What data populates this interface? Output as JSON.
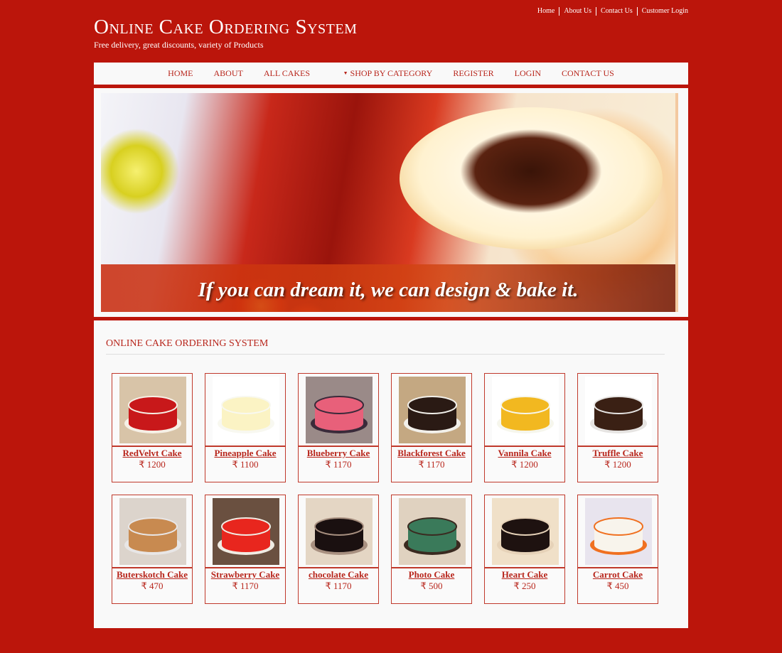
{
  "top_links": [
    "Home",
    "About Us",
    "Contact Us",
    "Customer Login"
  ],
  "brand": {
    "title": "Online Cake Ordering System",
    "tagline": "Free delivery, great discounts, variety of Products"
  },
  "main_nav": {
    "home": "HOME",
    "about": "ABOUT",
    "all_cakes": "ALL CAKES",
    "shop_by_category": "SHOP BY CATEGORY",
    "register": "REGISTER",
    "login": "LOGIN",
    "contact_us": "CONTACT US"
  },
  "banner": {
    "caption": "If you can dream it, we can design & bake it."
  },
  "section_title": "ONLINE CAKE ORDERING SYSTEM",
  "currency_symbol": "₹",
  "products": [
    {
      "name": "RedVelvt Cake",
      "price": "₹ 1200",
      "colors": [
        "#c8181a",
        "#f6f0e6",
        "#d8c4a8"
      ]
    },
    {
      "name": "Pineapple Cake",
      "price": "₹ 1100",
      "colors": [
        "#fbf3c4",
        "#f8f8f0",
        "#ffffff"
      ]
    },
    {
      "name": "Blueberry Cake",
      "price": "₹ 1170",
      "colors": [
        "#e8607a",
        "#3a2a3a",
        "#9a8a88"
      ]
    },
    {
      "name": "Blackforest Cake",
      "price": "₹ 1170",
      "colors": [
        "#2a1a14",
        "#f2f0ea",
        "#c4a882"
      ]
    },
    {
      "name": "Vannila Cake",
      "price": "₹ 1200",
      "colors": [
        "#f2b820",
        "#f6f6ec",
        "#ffffff"
      ]
    },
    {
      "name": "Truffle Cake",
      "price": "₹ 1200",
      "colors": [
        "#3a2014",
        "#e6e4e2",
        "#ffffff"
      ]
    },
    {
      "name": "Buterskotch Cake",
      "price": "₹ 470",
      "colors": [
        "#c88a50",
        "#e8e6e6",
        "#dcd4cc"
      ]
    },
    {
      "name": "Strawberry Cake",
      "price": "₹ 1170",
      "colors": [
        "#e8261e",
        "#f0ece4",
        "#6a5040"
      ]
    },
    {
      "name": "chocolate Cake",
      "price": "₹ 1170",
      "colors": [
        "#1a1010",
        "#a89080",
        "#e4d6c4"
      ]
    },
    {
      "name": "Photo Cake",
      "price": "₹ 500",
      "colors": [
        "#3a7a5a",
        "#3a2a20",
        "#e0d2c0"
      ]
    },
    {
      "name": "Heart Cake",
      "price": "₹ 250",
      "colors": [
        "#1e1210",
        "#e6d2b8",
        "#f0e0c8"
      ]
    },
    {
      "name": "Carrot Cake",
      "price": "₹ 450",
      "colors": [
        "#f8f4ec",
        "#f07020",
        "#e8e4ee"
      ]
    }
  ],
  "colors": {
    "brand_red": "#bb150b",
    "link_red": "#b8261c",
    "panel_bg": "#f9f9f9"
  }
}
